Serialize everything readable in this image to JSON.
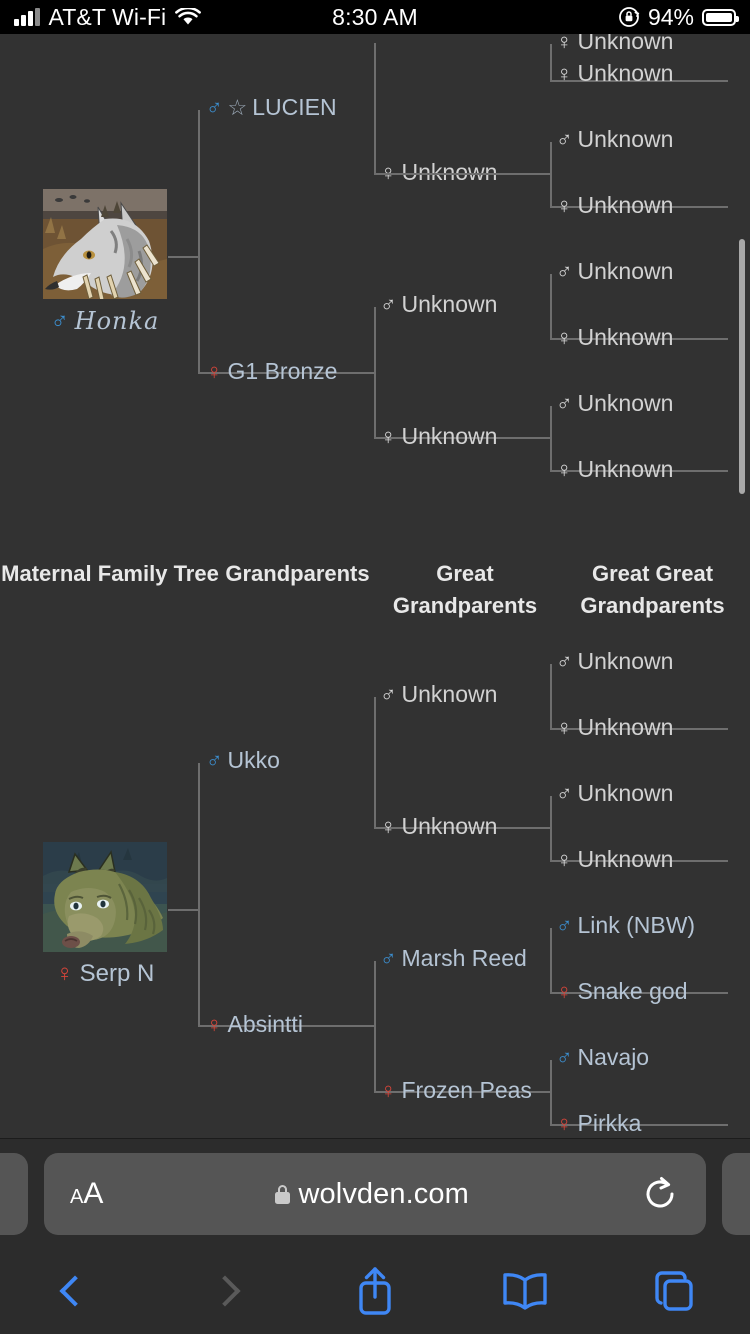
{
  "status_bar": {
    "carrier": "AT&T Wi-Fi",
    "time": "8:30 AM",
    "battery_percent": "94%",
    "signal_icon": "signal-bars-icon",
    "wifi_icon": "wifi-icon",
    "rotation_lock_icon": "rotation-lock-icon",
    "battery_icon": "battery-icon"
  },
  "paternal": {
    "subject": {
      "name": "Honka",
      "sex": "male",
      "symbol": "♂"
    },
    "parent": {
      "name": "LUCIEN",
      "sex": "male",
      "symbol": "♂",
      "starred": true,
      "star": "☆"
    },
    "parent2": {
      "name": "G1 Bronze",
      "sex": "female",
      "symbol": "♀"
    },
    "grandparents": [
      {
        "name": "Unknown",
        "sex": "unknown",
        "symbol": "♂"
      },
      {
        "name": "Unknown",
        "sex": "unknown",
        "symbol": "♀"
      },
      {
        "name": "Unknown",
        "sex": "unknown",
        "symbol": "♂"
      },
      {
        "name": "Unknown",
        "sex": "unknown",
        "symbol": "♀"
      }
    ],
    "great_great": [
      {
        "name": "Unknown",
        "sex": "unknown",
        "symbol": "♀"
      },
      {
        "name": "Unknown",
        "sex": "unknown",
        "symbol": "♂"
      },
      {
        "name": "Unknown",
        "sex": "unknown",
        "symbol": "♀"
      },
      {
        "name": "Unknown",
        "sex": "unknown",
        "symbol": "♂"
      },
      {
        "name": "Unknown",
        "sex": "unknown",
        "symbol": "♀"
      },
      {
        "name": "Unknown",
        "sex": "unknown",
        "symbol": "♂"
      },
      {
        "name": "Unknown",
        "sex": "unknown",
        "symbol": "♀"
      }
    ]
  },
  "headers": [
    "Maternal Family Tree",
    "Grandparents",
    "Great Grandparents",
    "Great Great Grandparents"
  ],
  "maternal": {
    "subject": {
      "name": "Serp N",
      "sex": "female",
      "symbol": "♀"
    },
    "parent": {
      "name": "Ukko",
      "sex": "male",
      "symbol": "♂"
    },
    "parent2": {
      "name": "Absintti",
      "sex": "female",
      "symbol": "♀"
    },
    "grandparents": [
      {
        "name": "Unknown",
        "sex": "unknown",
        "symbol": "♂"
      },
      {
        "name": "Unknown",
        "sex": "unknown",
        "symbol": "♀"
      },
      {
        "name": "Marsh Reed",
        "sex": "male",
        "symbol": "♂"
      },
      {
        "name": "Frozen Peas",
        "sex": "female",
        "symbol": "♀"
      }
    ],
    "great_great": [
      {
        "name": "Unknown",
        "sex": "unknown",
        "symbol": "♂"
      },
      {
        "name": "Unknown",
        "sex": "unknown",
        "symbol": "♀"
      },
      {
        "name": "Unknown",
        "sex": "unknown",
        "symbol": "♂"
      },
      {
        "name": "Unknown",
        "sex": "unknown",
        "symbol": "♀"
      },
      {
        "name": "Link (NBW)",
        "sex": "male",
        "symbol": "♂"
      },
      {
        "name": "Snake god",
        "sex": "female",
        "symbol": "♀"
      },
      {
        "name": "Navajo",
        "sex": "male",
        "symbol": "♂"
      },
      {
        "name": "Pirkka",
        "sex": "female",
        "symbol": "♀"
      }
    ]
  },
  "browser": {
    "text_size_small": "A",
    "text_size_big": "A",
    "lock_icon": "lock-icon",
    "url": "wolvden.com",
    "reload_icon": "reload-icon",
    "back_icon": "back-chevron-icon",
    "forward_icon": "forward-chevron-icon",
    "share_icon": "share-icon",
    "bookmarks_icon": "bookmarks-icon",
    "tabs_icon": "tabs-icon"
  },
  "colors": {
    "page_bg": "#323232",
    "male": "#3c8fd0",
    "female": "#d8453a",
    "link": "#b5c4d4",
    "line": "#6e6e6e",
    "safari_accent": "#3f87f5"
  }
}
